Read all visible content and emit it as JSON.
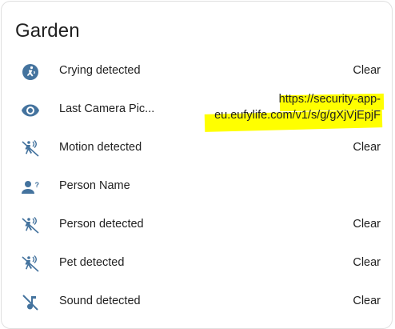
{
  "card": {
    "title": "Garden"
  },
  "rows": [
    {
      "icon": "baby-cry-icon",
      "name": "Crying detected",
      "state": "Clear"
    },
    {
      "icon": "eye-icon",
      "name": "Last Camera Pic...",
      "state_line1": "https://security-app-",
      "state_line2": "eu.eufylife.com/v1/s/g/gXjVjEpjF"
    },
    {
      "icon": "motion-sensor-icon",
      "name": "Motion detected",
      "state": "Clear"
    },
    {
      "icon": "account-question-icon",
      "name": "Person Name",
      "state": ""
    },
    {
      "icon": "motion-sensor-icon",
      "name": "Person detected",
      "state": "Clear"
    },
    {
      "icon": "motion-sensor-icon",
      "name": "Pet detected",
      "state": "Clear"
    },
    {
      "icon": "music-note-off-icon",
      "name": "Sound detected",
      "state": "Clear"
    }
  ],
  "colors": {
    "icon": "#44739e",
    "text": "#212121",
    "highlight": "#ffff00"
  }
}
